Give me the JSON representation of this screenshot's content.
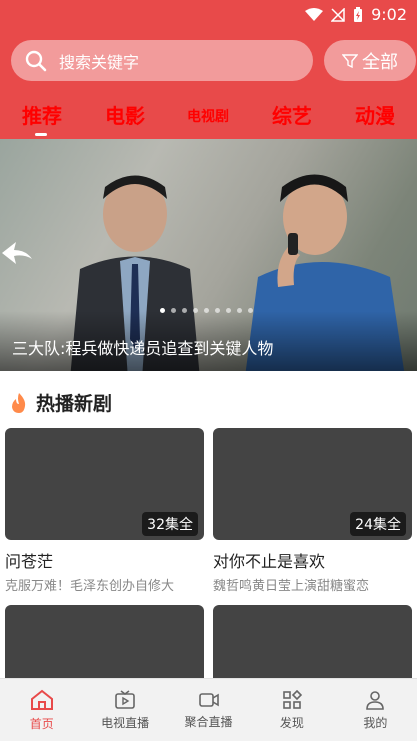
{
  "status": {
    "time": "9:02"
  },
  "search": {
    "placeholder": "搜索关键字"
  },
  "filter": {
    "label": "全部"
  },
  "tabs": [
    {
      "label": "推荐",
      "active": true
    },
    {
      "label": "电影"
    },
    {
      "label": "电视剧"
    },
    {
      "label": "综艺"
    },
    {
      "label": "动漫"
    }
  ],
  "banner": {
    "caption": "三大队:程兵做快递员追查到关键人物",
    "dot_count": 9,
    "active_dot": 0
  },
  "section": {
    "title": "热播新剧",
    "icon": "flame-icon"
  },
  "cards": [
    {
      "title": "问苍茫",
      "subtitle": "克服万难！毛泽东创办自修大",
      "badge": "32集全"
    },
    {
      "title": "对你不止是喜欢",
      "subtitle": "魏哲鸣黄日莹上演甜糖蜜恋",
      "badge": "24集全"
    }
  ],
  "nav": [
    {
      "label": "首页",
      "icon": "home-icon",
      "active": true
    },
    {
      "label": "电视直播",
      "icon": "tv-icon"
    },
    {
      "label": "聚合直播",
      "icon": "video-camera-icon"
    },
    {
      "label": "发现",
      "icon": "discover-grid-icon"
    },
    {
      "label": "我的",
      "icon": "user-icon"
    }
  ],
  "colors": {
    "brand": "#e84a4a",
    "tab_text": "#ff0000",
    "card_placeholder": "#444444"
  }
}
